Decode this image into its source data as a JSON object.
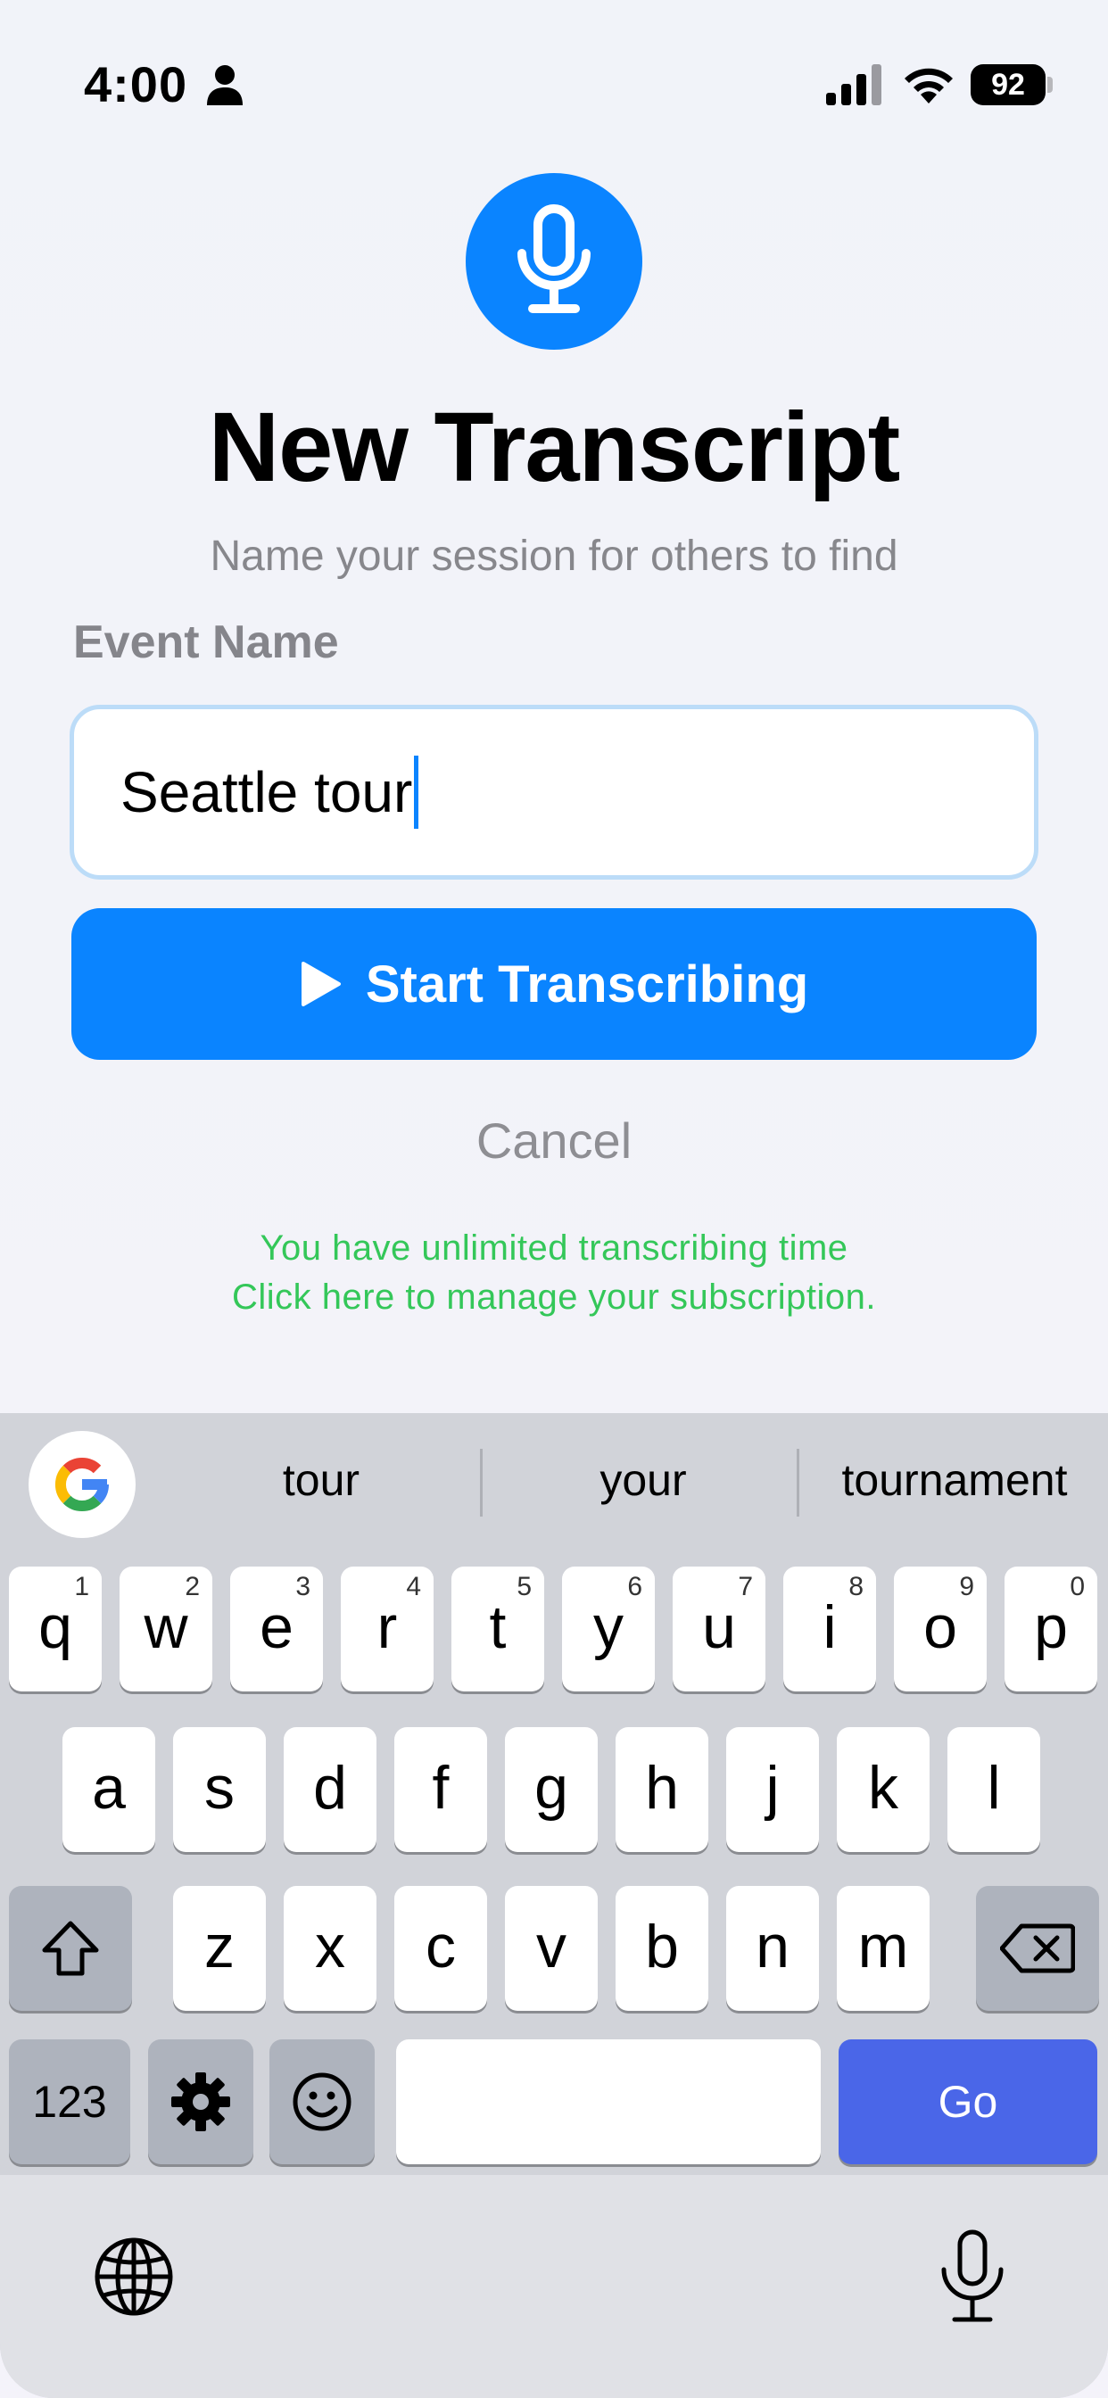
{
  "status_bar": {
    "time": "4:00",
    "battery": "92",
    "icons": [
      "person-icon",
      "cellular-signal-icon",
      "wifi-icon",
      "battery-icon"
    ]
  },
  "header": {
    "icon": "microphone-icon",
    "title": "New Transcript",
    "subtitle": "Name your session for others to find"
  },
  "form": {
    "label": "Event Name",
    "input_value": "Seattle tour",
    "start_button_label": "Start Transcribing",
    "start_button_icon": "play-icon",
    "cancel_label": "Cancel"
  },
  "subscription": {
    "line1": "You have unlimited transcribing time",
    "line2": "Click here to manage your subscription."
  },
  "keyboard": {
    "suggestions": [
      "tour",
      "your",
      "tournament"
    ],
    "row1": [
      {
        "letter": "q",
        "digit": "1"
      },
      {
        "letter": "w",
        "digit": "2"
      },
      {
        "letter": "e",
        "digit": "3"
      },
      {
        "letter": "r",
        "digit": "4"
      },
      {
        "letter": "t",
        "digit": "5"
      },
      {
        "letter": "y",
        "digit": "6"
      },
      {
        "letter": "u",
        "digit": "7"
      },
      {
        "letter": "i",
        "digit": "8"
      },
      {
        "letter": "o",
        "digit": "9"
      },
      {
        "letter": "p",
        "digit": "0"
      }
    ],
    "row2": [
      "a",
      "s",
      "d",
      "f",
      "g",
      "h",
      "j",
      "k",
      "l"
    ],
    "row3": [
      "z",
      "x",
      "c",
      "v",
      "b",
      "n",
      "m"
    ],
    "numbers_label": "123",
    "go_label": "Go"
  },
  "colors": {
    "accent": "#0a84ff",
    "success": "#34c759",
    "go_key": "#4a66e8"
  }
}
